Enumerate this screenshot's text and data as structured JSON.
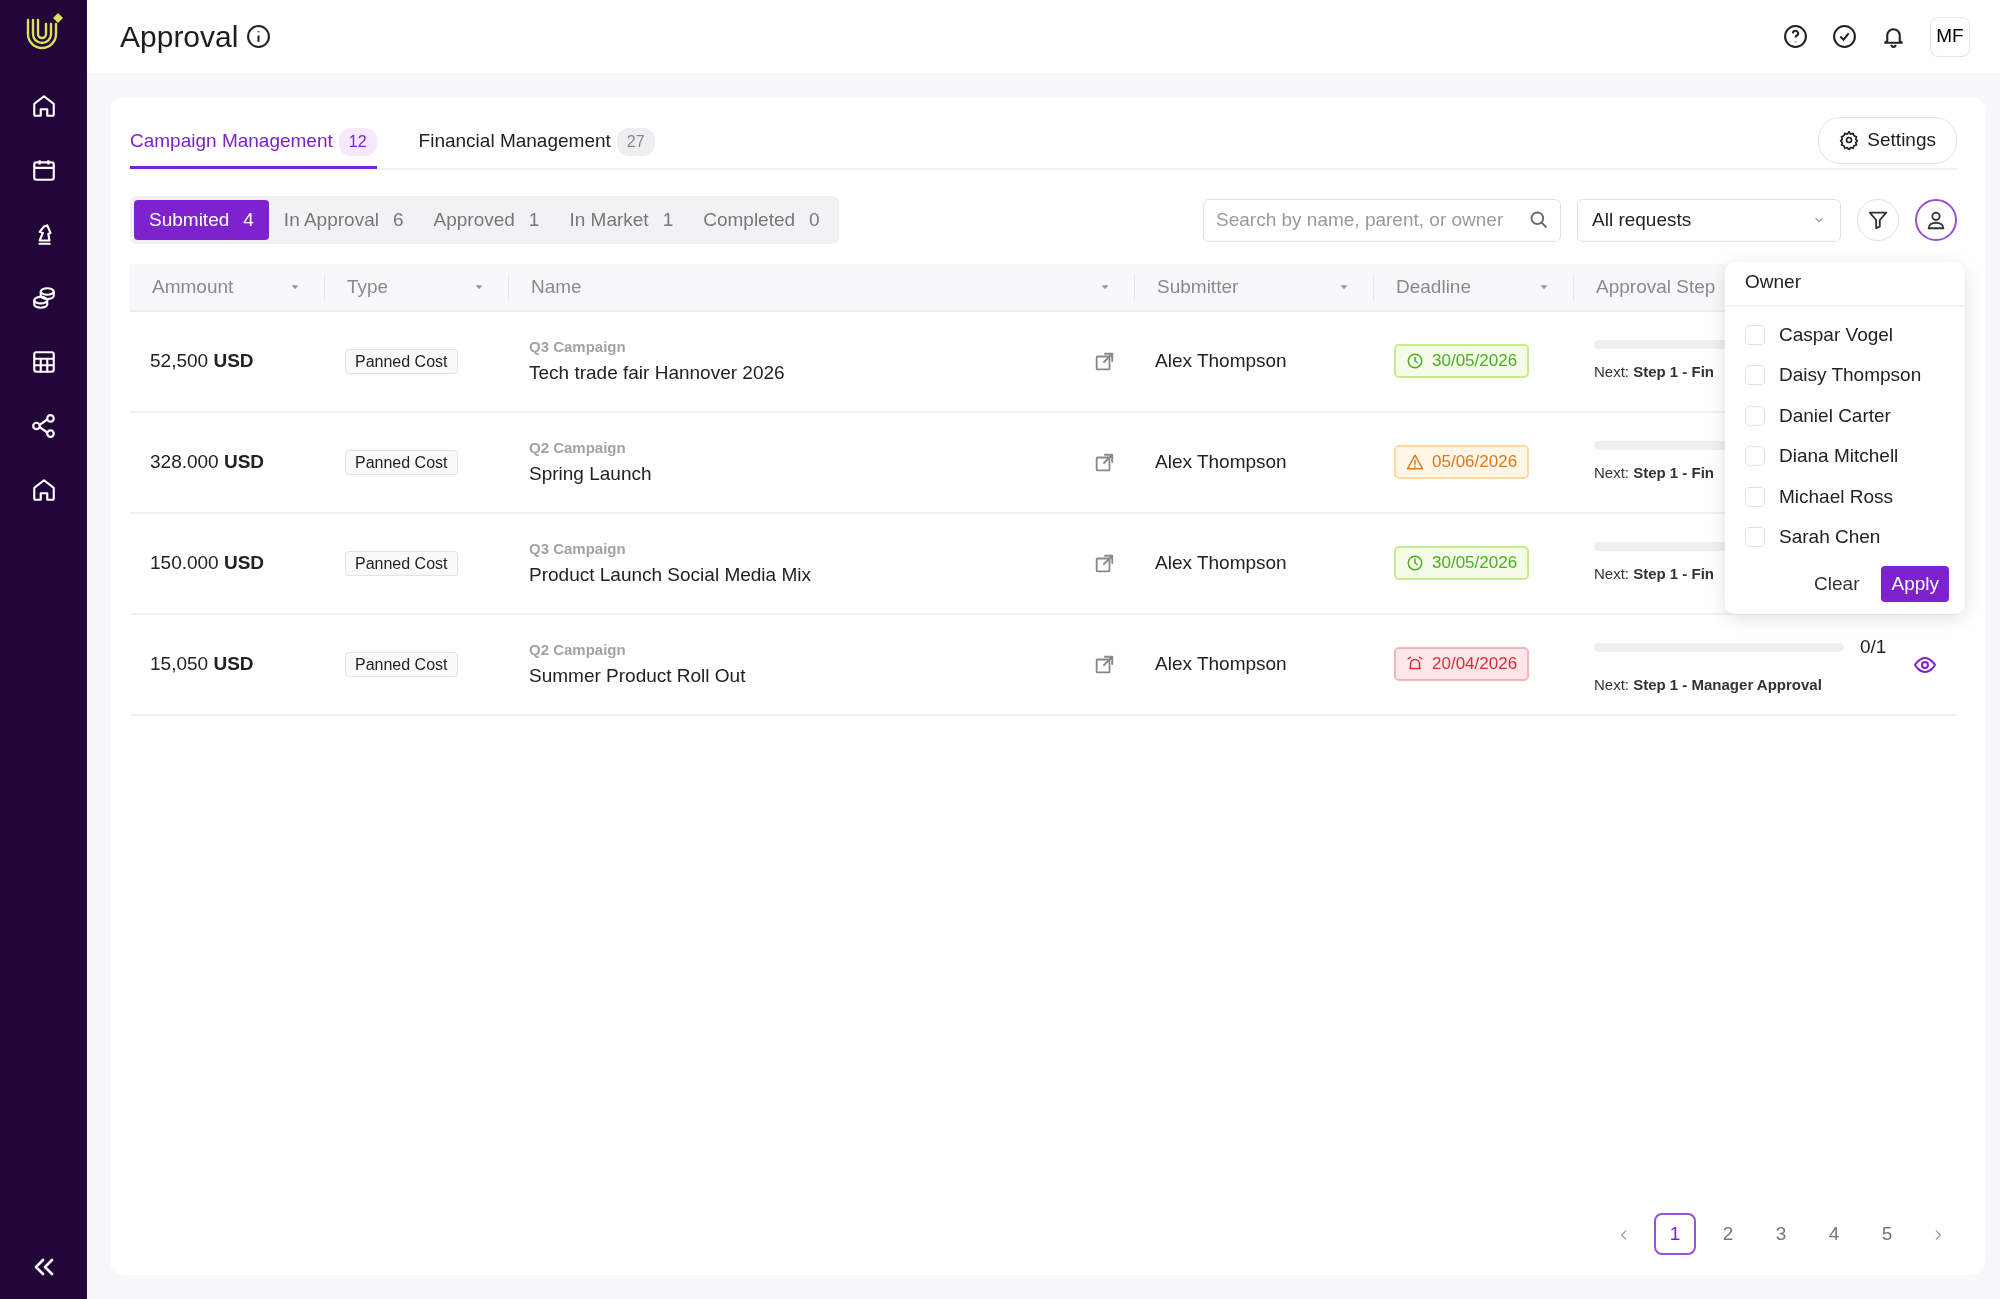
{
  "header": {
    "title": "Approval",
    "avatar": "MF"
  },
  "tabs": [
    {
      "label": "Campaign Management",
      "count": "12",
      "selected": true
    },
    {
      "label": "Financial Management",
      "count": "27",
      "selected": false
    }
  ],
  "settings_button": "Settings",
  "status_filters": [
    {
      "label": "Submited",
      "count": "4",
      "selected": true
    },
    {
      "label": "In Approval",
      "count": "6",
      "selected": false
    },
    {
      "label": "Approved",
      "count": "1",
      "selected": false
    },
    {
      "label": "In Market",
      "count": "1",
      "selected": false
    },
    {
      "label": "Completed",
      "count": "0",
      "selected": false
    }
  ],
  "search": {
    "placeholder": "Search by name, parent, or owner"
  },
  "request_select": {
    "value": "All requests"
  },
  "owner_filter": {
    "expanded": true,
    "title": "Owner",
    "options": [
      {
        "label": "Caspar Vogel",
        "checked": false
      },
      {
        "label": "Daisy Thompson",
        "checked": false
      },
      {
        "label": "Daniel Carter",
        "checked": false
      },
      {
        "label": "Diana Mitchell",
        "checked": false
      },
      {
        "label": "Michael Ross",
        "checked": false
      },
      {
        "label": "Sarah Chen",
        "checked": false
      }
    ],
    "clear": "Clear",
    "apply": "Apply"
  },
  "table": {
    "columns": [
      "Ammount",
      "Type",
      "Name",
      "Submitter",
      "Deadline",
      "Approval Step"
    ],
    "rows": [
      {
        "amount": "52,500 **USD**",
        "type": "Panned Cost",
        "parent": "Q3 Campaign",
        "name": "Tech trade fair Hannover 2026",
        "submitter": "Alex Thompson",
        "deadline": {
          "date": "30/05/2026",
          "kind": "ok"
        },
        "approval": {
          "level": 0,
          "next": "Next: **Step 1 - Fin**"
        }
      },
      {
        "amount": "328.000 **USD**",
        "type": "Panned Cost",
        "parent": "Q2 Campaign",
        "name": "Spring Launch",
        "submitter": "Alex Thompson",
        "deadline": {
          "date": "05/06/2026",
          "kind": "warning"
        },
        "approval": {
          "level": 0,
          "next": "Next: **Step 1 - Fin**"
        }
      },
      {
        "amount": "150.000 **USD**",
        "type": "Panned Cost",
        "parent": "Q3 Campaign",
        "name": "Product Launch Social Media Mix",
        "submitter": "Alex Thompson",
        "deadline": {
          "date": "30/05/2026",
          "kind": "ok"
        },
        "approval": {
          "level": 0,
          "next": "Next: **Step 1 - Fin**"
        }
      },
      {
        "amount": "15,050 **USD**",
        "type": "Panned Cost",
        "parent": "Q2 Campaign",
        "name": "Summer Product Roll Out",
        "submitter": "Alex Thompson",
        "deadline": {
          "date": "20/04/2026",
          "kind": "overdue"
        },
        "approval": {
          "level": 0,
          "progress": "0/1",
          "next": "Next: **Step 1 - Manager Approval**"
        }
      }
    ]
  },
  "pagination": {
    "pages": [
      {
        "label": "1",
        "selected": true
      },
      {
        "label": "2",
        "selected": false
      },
      {
        "label": "3",
        "selected": false
      },
      {
        "label": "4",
        "selected": false
      },
      {
        "label": "5",
        "selected": false
      }
    ]
  }
}
